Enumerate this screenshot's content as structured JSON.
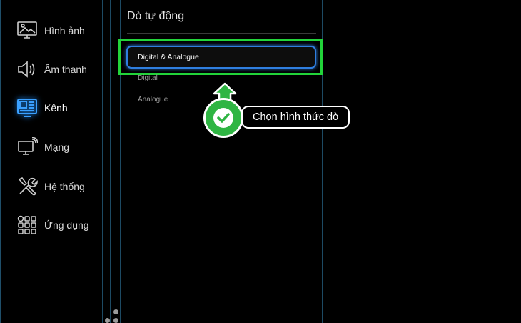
{
  "sidebar": {
    "items": [
      {
        "label": "Hình ảnh",
        "icon": "picture-icon"
      },
      {
        "label": "Âm thanh",
        "icon": "speaker-icon"
      },
      {
        "label": "Kênh",
        "icon": "channel-icon",
        "active": true
      },
      {
        "label": "Mạng",
        "icon": "network-icon"
      },
      {
        "label": "Hệ thống",
        "icon": "tools-icon"
      },
      {
        "label": "Ứng dụng",
        "icon": "apps-icon"
      }
    ]
  },
  "panel": {
    "title": "Dò tự động",
    "options": [
      {
        "label": "Digital & Analogue",
        "selected": true
      },
      {
        "label": "Digital"
      },
      {
        "label": "Analogue"
      }
    ]
  },
  "callout": {
    "text": "Chọn hình thức dò"
  },
  "colors": {
    "accent_green": "#22d43a",
    "focus_blue": "#2f7fe0",
    "active_icon": "#1e90ff",
    "divider": "#1d4a63"
  }
}
